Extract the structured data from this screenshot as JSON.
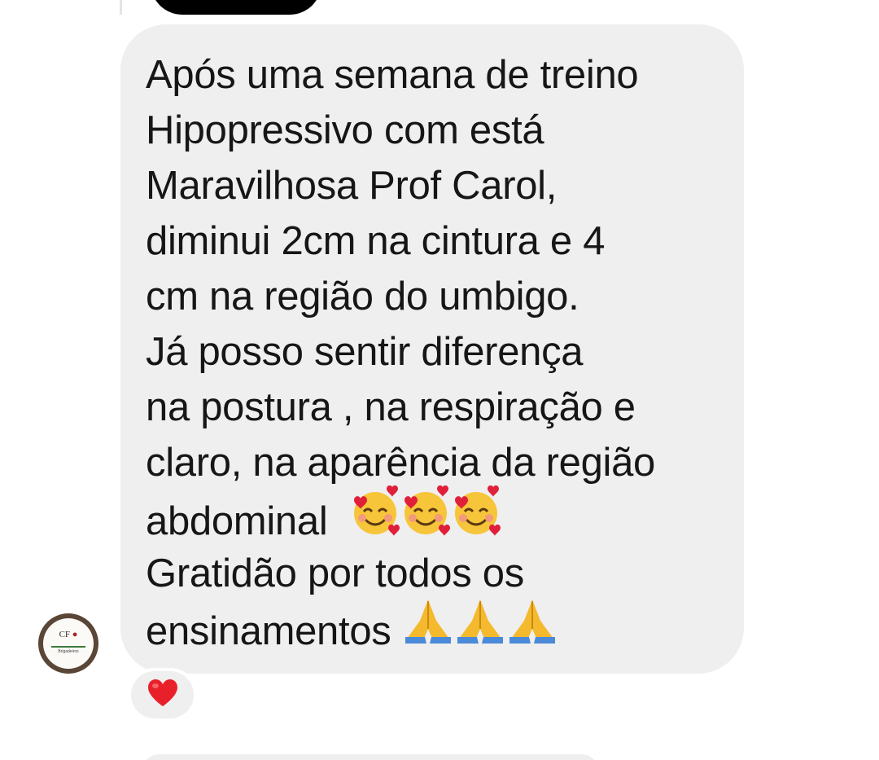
{
  "message": {
    "lines": [
      "Após uma semana de treino",
      "Hipopressivo com está",
      "Maravilhosa Prof Carol,",
      "diminui 2cm na cintura e 4",
      "cm na região do umbigo.",
      "Já posso sentir diferença",
      "na postura , na respiração e",
      "claro, na aparência da região",
      "abdominal",
      "Gratidão por todos os",
      "ensinamentos"
    ],
    "emoji_hearts": "smiling-face-with-hearts",
    "emoji_pray": "folded-hands"
  },
  "avatar": {
    "logo_text": "CF",
    "brand_text": "Brigadeiros"
  },
  "reaction": {
    "emoji": "red-heart",
    "color": "#e8202a"
  },
  "colors": {
    "bubble": "#efefef",
    "text": "#161616",
    "background": "#ffffff"
  }
}
